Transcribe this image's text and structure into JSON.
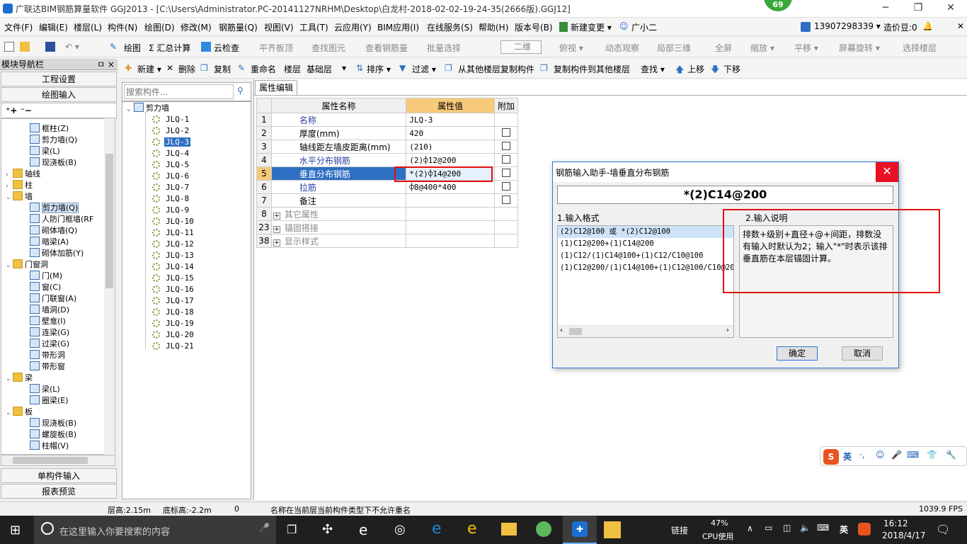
{
  "window": {
    "title": "广联达BIM钢筋算量软件 GGJ2013 - [C:\\Users\\Administrator.PC-20141127NRHM\\Desktop\\白龙村-2018-02-02-19-24-35(2666版).GGJ12]",
    "badge": "69",
    "minimize": "─",
    "restore": "❐",
    "close": "✕"
  },
  "menu": [
    "文件(F)",
    "编辑(E)",
    "楼层(L)",
    "构件(N)",
    "绘图(D)",
    "修改(M)",
    "钢筋量(Q)",
    "视图(V)",
    "工具(T)",
    "云应用(Y)",
    "BIM应用(I)",
    "在线服务(S)",
    "帮助(H)",
    "版本号(B)",
    "新建变更 ▾",
    "广小二",
    "13907298339 ▾",
    "造价豆:0"
  ],
  "toolbar1": [
    "绘图",
    "Σ 汇总计算",
    "云检查",
    "平齐板顶",
    "查找图元",
    "查看钢筋量",
    "批量选择",
    "二维",
    "俯视 ▾",
    "动态观察",
    "局部三维",
    "全屏",
    "缩放 ▾",
    "平移 ▾",
    "屏幕旋转 ▾",
    "选择楼层"
  ],
  "toolbar2": [
    "新建 ▾",
    "删除",
    "复制",
    "重命名",
    "楼层",
    "基础层",
    "排序 ▾",
    "过滤 ▾",
    "从其他楼层复制构件",
    "复制构件到其他楼层",
    "查找 ▾",
    "上移",
    "下移"
  ],
  "nav": {
    "header": "模块导航栏",
    "pin": "ㅁ ×",
    "project_settings": "工程设置",
    "drawing_input": "绘图输入",
    "single_input": "单构件输入",
    "report_preview": "报表预览",
    "expand_all": "⁺+ ⁻−",
    "items": [
      {
        "label": "框柱(Z)",
        "level": 2,
        "type": "comp"
      },
      {
        "label": "剪力墙(Q)",
        "level": 2,
        "type": "comp"
      },
      {
        "label": "梁(L)",
        "level": 2,
        "type": "comp"
      },
      {
        "label": "现浇板(B)",
        "level": 2,
        "type": "comp"
      },
      {
        "label": "轴线",
        "level": 1,
        "type": "folder",
        "tri": "›"
      },
      {
        "label": "柱",
        "level": 1,
        "type": "folder",
        "tri": "›"
      },
      {
        "label": "墙",
        "level": 1,
        "type": "folder",
        "tri": "⌄"
      },
      {
        "label": "剪力墙(Q)",
        "level": 2,
        "type": "comp",
        "selected": true
      },
      {
        "label": "人防门框墙(RF",
        "level": 2,
        "type": "comp"
      },
      {
        "label": "砌体墙(Q)",
        "level": 2,
        "type": "comp"
      },
      {
        "label": "暗梁(A)",
        "level": 2,
        "type": "comp"
      },
      {
        "label": "砌体加筋(Y)",
        "level": 2,
        "type": "comp"
      },
      {
        "label": "门窗洞",
        "level": 1,
        "type": "folder",
        "tri": "⌄"
      },
      {
        "label": "门(M)",
        "level": 2,
        "type": "comp"
      },
      {
        "label": "窗(C)",
        "level": 2,
        "type": "comp"
      },
      {
        "label": "门联窗(A)",
        "level": 2,
        "type": "comp"
      },
      {
        "label": "墙洞(D)",
        "level": 2,
        "type": "comp"
      },
      {
        "label": "壁龛(I)",
        "level": 2,
        "type": "comp"
      },
      {
        "label": "连梁(G)",
        "level": 2,
        "type": "comp"
      },
      {
        "label": "过梁(G)",
        "level": 2,
        "type": "comp"
      },
      {
        "label": "带形洞",
        "level": 2,
        "type": "comp"
      },
      {
        "label": "带形窗",
        "level": 2,
        "type": "comp"
      },
      {
        "label": "梁",
        "level": 1,
        "type": "folder",
        "tri": "⌄"
      },
      {
        "label": "梁(L)",
        "level": 2,
        "type": "comp"
      },
      {
        "label": "圈梁(E)",
        "level": 2,
        "type": "comp"
      },
      {
        "label": "板",
        "level": 1,
        "type": "folder",
        "tri": "⌄"
      },
      {
        "label": "现浇板(B)",
        "level": 2,
        "type": "comp"
      },
      {
        "label": "螺旋板(B)",
        "level": 2,
        "type": "comp"
      },
      {
        "label": "柱帽(V)",
        "level": 2,
        "type": "comp"
      }
    ]
  },
  "component_list": {
    "search_placeholder": "搜索构件...",
    "root": "剪力墙",
    "items": [
      "JLQ-1",
      "JLQ-2",
      "JLQ-3",
      "JLQ-4",
      "JLQ-5",
      "JLQ-6",
      "JLQ-7",
      "JLQ-8",
      "JLQ-9",
      "JLQ-10",
      "JLQ-11",
      "JLQ-12",
      "JLQ-13",
      "JLQ-14",
      "JLQ-15",
      "JLQ-16",
      "JLQ-17",
      "JLQ-18",
      "JLQ-19",
      "JLQ-20",
      "JLQ-21"
    ],
    "selected": "JLQ-3"
  },
  "property_tab": "属性编辑",
  "property_grid": {
    "headers": [
      "属性名称",
      "属性值",
      "附加"
    ],
    "rows": [
      {
        "num": "1",
        "name": "名称",
        "value": "JLQ-3",
        "blue": true,
        "check": false
      },
      {
        "num": "2",
        "name": "厚度(mm)",
        "value": "420",
        "blue": false,
        "check": true
      },
      {
        "num": "3",
        "name": "轴线距左墙皮距离(mm)",
        "value": "(210)",
        "blue": false,
        "check": true
      },
      {
        "num": "4",
        "name": "水平分布钢筋",
        "value": "(2)⌽12@200",
        "blue": true,
        "check": true
      },
      {
        "num": "5",
        "name": "垂直分布钢筋",
        "value": "*(2)⌽14@200",
        "blue": true,
        "check": true,
        "selected": true
      },
      {
        "num": "6",
        "name": "拉筋",
        "value": "⌽8@400*400",
        "blue": true,
        "check": true
      },
      {
        "num": "7",
        "name": "备注",
        "value": "",
        "blue": false,
        "check": true
      },
      {
        "num": "8",
        "name": "其它属性",
        "value": "",
        "group": true
      },
      {
        "num": "23",
        "name": "锚固搭接",
        "value": "",
        "group": true
      },
      {
        "num": "38",
        "name": "显示样式",
        "value": "",
        "group": true
      }
    ]
  },
  "dialog": {
    "title": "钢筋输入助手-墙垂直分布钢筋",
    "value": "*(2)C14@200",
    "format_label": "1.输入格式",
    "desc_label": "2.输入说明",
    "formats": [
      "(2)C12@100 或 *(2)C12@100",
      "(1)C12@200+(1)C14@200",
      "(1)C12/(1)C14@100+(1)C12/C10@100",
      "(1)C12@200/(1)C14@100+(1)C12@100/C10@200"
    ],
    "description": "排数+级别+直径+@+间距，排数没有输入时默认为2；输入\"*\"时表示该排垂直筋在本层锚固计算。",
    "ok": "确定",
    "cancel": "取消",
    "close": "✕"
  },
  "statusbar": {
    "floor_height": "层高:2.15m",
    "bottom_height": "底标高:-2.2m",
    "zero": "0",
    "message": "名称在当前层当前构件类型下不允许重名",
    "fps": "1039.9 FPS"
  },
  "ime": [
    "英",
    "·,",
    "☺",
    "🎤",
    "⌨",
    "👕",
    "🔧"
  ],
  "taskbar": {
    "search_placeholder": "在这里输入你要搜索的内容",
    "link": "链接",
    "cpu_pct": "47%",
    "cpu_label": "CPU使用",
    "time": "16:12",
    "date": "2018/4/17",
    "lang": "英"
  },
  "colors": {
    "accent": "#2f6fc3",
    "highlight_red": "#e01010",
    "header_orange": "#f7c97a"
  }
}
